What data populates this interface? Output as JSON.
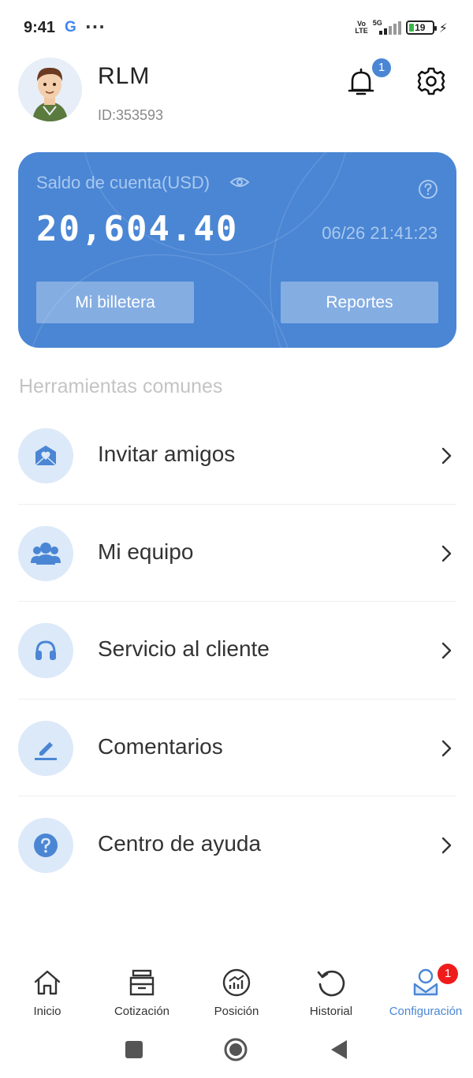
{
  "status_bar": {
    "time": "9:41",
    "google": "G",
    "more": "···",
    "volte_line1": "Vo",
    "volte_line2": "LTE",
    "network": "5G",
    "battery": "19"
  },
  "profile": {
    "name": "RLM",
    "id": "ID:353593",
    "notifications_count": "1"
  },
  "balance_card": {
    "label": "Saldo de cuenta(USD)",
    "amount": "20,604.40",
    "timestamp": "06/26 21:41:23",
    "wallet_button": "Mi billetera",
    "reports_button": "Reportes",
    "color": "#4a86d4"
  },
  "tools": {
    "title": "Herramientas comunes",
    "items": [
      {
        "label": "Invitar amigos",
        "icon": "invite-mail-icon"
      },
      {
        "label": "Mi equipo",
        "icon": "team-icon"
      },
      {
        "label": "Servicio al cliente",
        "icon": "headset-icon"
      },
      {
        "label": "Comentarios",
        "icon": "edit-pencil-icon"
      },
      {
        "label": "Centro de ayuda",
        "icon": "help-icon"
      }
    ]
  },
  "bottom_nav": {
    "items": [
      {
        "label": "Inicio",
        "icon": "home-icon"
      },
      {
        "label": "Cotización",
        "icon": "quote-box-icon"
      },
      {
        "label": "Posición",
        "icon": "position-chart-icon"
      },
      {
        "label": "Historial",
        "icon": "history-icon"
      },
      {
        "label": "Configuración",
        "icon": "profile-settings-icon",
        "active": true,
        "badge": "1"
      }
    ],
    "active_color": "#4a86d4",
    "badge_color": "#f01c1c"
  }
}
